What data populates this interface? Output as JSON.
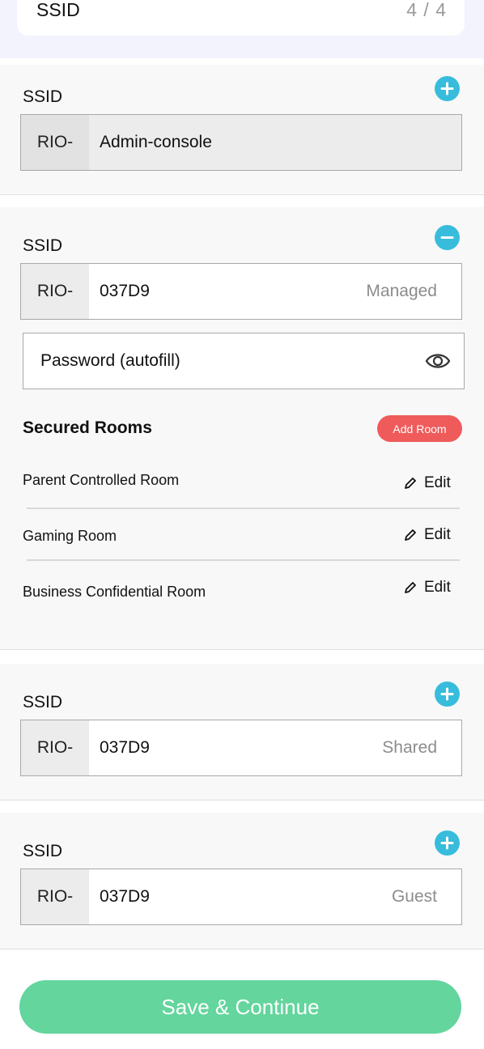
{
  "header": {
    "ssid_label": "SSID",
    "step_count": "4 / 4"
  },
  "networks": [
    {
      "label": "SSID",
      "prefix": "RIO-",
      "value": "Admin-console",
      "type": "",
      "action": "add"
    },
    {
      "label": "SSID",
      "prefix": "RIO-",
      "value": "037D9",
      "type": "Managed",
      "action": "remove"
    },
    {
      "label": "SSID",
      "prefix": "RIO-",
      "value": "037D9",
      "type": "Shared",
      "action": "add"
    },
    {
      "label": "SSID",
      "prefix": "RIO-",
      "value": "037D9",
      "type": "Guest",
      "action": "add"
    }
  ],
  "password": {
    "placeholder": "Password (autofill)",
    "icon": "eye-icon"
  },
  "secured_rooms": {
    "title": "Secured Rooms",
    "add_label": "Add Room",
    "edit_label": "Edit",
    "rooms": [
      "Parent Controlled Room",
      "Gaming Room",
      "Business Confidential Room"
    ]
  },
  "footer": {
    "save_label": "Save & Continue"
  },
  "colors": {
    "accent_blue": "#38bcdc",
    "add_room_red": "#ef5b5b",
    "save_green": "#63d59d"
  }
}
